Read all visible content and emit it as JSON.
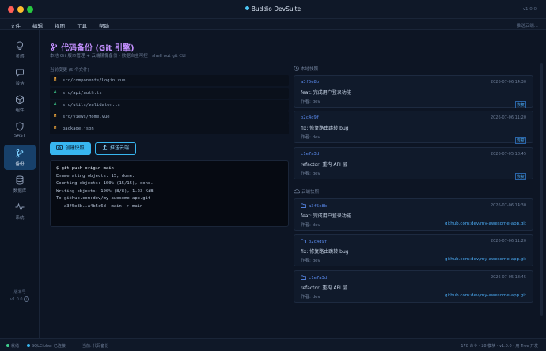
{
  "app": {
    "title": "Buddio DevSuite",
    "version_top": "v1.0.0",
    "accent": "#38b6f0"
  },
  "menu": {
    "items": [
      "文件",
      "编辑",
      "视图",
      "工具",
      "帮助"
    ],
    "right": "推送云端..."
  },
  "sidebar": {
    "items": [
      {
        "label": "灵感",
        "icon": "lightbulb-icon"
      },
      {
        "label": "会话",
        "icon": "chat-icon"
      },
      {
        "label": "组件",
        "icon": "component-icon"
      },
      {
        "label": "SAST",
        "icon": "shield-icon"
      },
      {
        "label": "备份",
        "icon": "git-branch-icon"
      },
      {
        "label": "数据库",
        "icon": "database-icon"
      },
      {
        "label": "系统",
        "icon": "activity-icon"
      }
    ],
    "active_index": 4,
    "footer_line1": "版本号",
    "footer_line2": "v1.0.0"
  },
  "page": {
    "title": "代码备份 (Git 引擎)",
    "subtitle": "本地 Git 版本管理 + 云端镜像备份 · 数据自主可控 · shell out git CLI"
  },
  "changes": {
    "label": "当前变更 (5 个文件)",
    "files": [
      {
        "status": "M",
        "path": "src/components/Login.vue"
      },
      {
        "status": "A",
        "path": "src/api/auth.ts"
      },
      {
        "status": "A",
        "path": "src/utils/validator.ts"
      },
      {
        "status": "M",
        "path": "src/views/Home.vue"
      },
      {
        "status": "M",
        "path": "package.json"
      }
    ]
  },
  "actions": {
    "snapshot_label": "创建快照",
    "push_label": "推送云端"
  },
  "terminal": {
    "lines": [
      "$ git push origin main",
      "Enumerating objects: 15, done.",
      "Counting objects: 100% (15/15), done.",
      "Writing objects: 100% (8/8), 1.23 KiB",
      "To github.com:dev/my-awesome-app.git",
      "   a3f5e8b..a4b5c6d  main -> main"
    ]
  },
  "local": {
    "heading": "本地快照",
    "restore_label": "恢复",
    "snapshots": [
      {
        "hash": "a3f5e8b",
        "time": "2026-07-06 14:30",
        "message": "feat: 完成用户登录功能",
        "author": "作者: dev"
      },
      {
        "hash": "b2c4d9f",
        "time": "2026-07-06 11:20",
        "message": "fix: 修复路由跳转 bug",
        "author": "作者: dev"
      },
      {
        "hash": "c1e7a3d",
        "time": "2026-07-05 18:45",
        "message": "refactor: 重构 API 层",
        "author": "作者: dev"
      }
    ]
  },
  "cloud": {
    "heading": "云端快照",
    "snapshots": [
      {
        "hash": "a3f5e8b",
        "time": "2026-07-06 14:30",
        "message": "feat: 完成用户登录功能",
        "author": "作者: dev",
        "remote": "github.com:dev/my-awesome-app.git"
      },
      {
        "hash": "b2c4d9f",
        "time": "2026-07-06 11:20",
        "message": "fix: 修复路由跳转 bug",
        "author": "作者: dev",
        "remote": "github.com:dev/my-awesome-app.git"
      },
      {
        "hash": "c1e7a3d",
        "time": "2026-07-05 18:45",
        "message": "refactor: 重构 API 层",
        "author": "作者: dev",
        "remote": "github.com:dev/my-awesome-app.git"
      }
    ]
  },
  "status": {
    "left1": "就绪",
    "left2": "SQLCipher 已连接",
    "left3": "当前: 代码备份",
    "right": "178 命令 · 28 模块 · v1.0.0 · 用 Tree 开发"
  }
}
